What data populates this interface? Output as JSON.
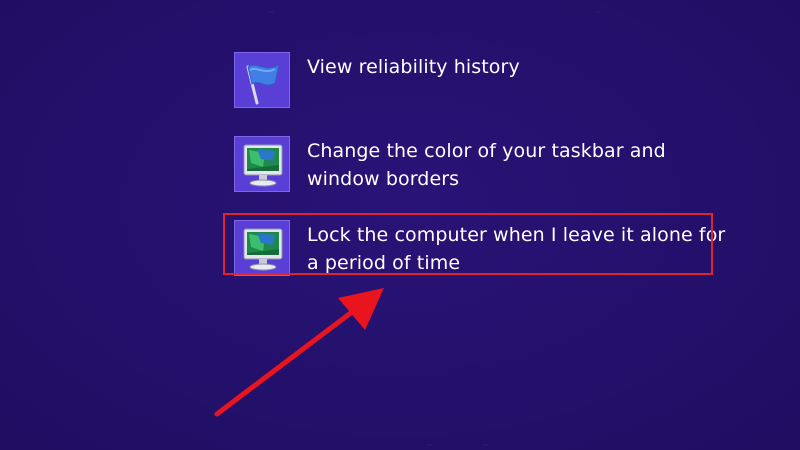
{
  "results": [
    {
      "label": "View reliability history",
      "icon": "flag-icon"
    },
    {
      "label": "Change the color of your taskbar and window borders",
      "icon": "monitor-icon"
    },
    {
      "label": "Lock the computer when I leave it alone for a period of time",
      "icon": "monitor-icon"
    }
  ],
  "annotation": {
    "highlight_color": "#e0242f",
    "arrow_color": "#e8141e"
  },
  "colors": {
    "background": "#24106a",
    "tile": "#5a3fd6"
  }
}
